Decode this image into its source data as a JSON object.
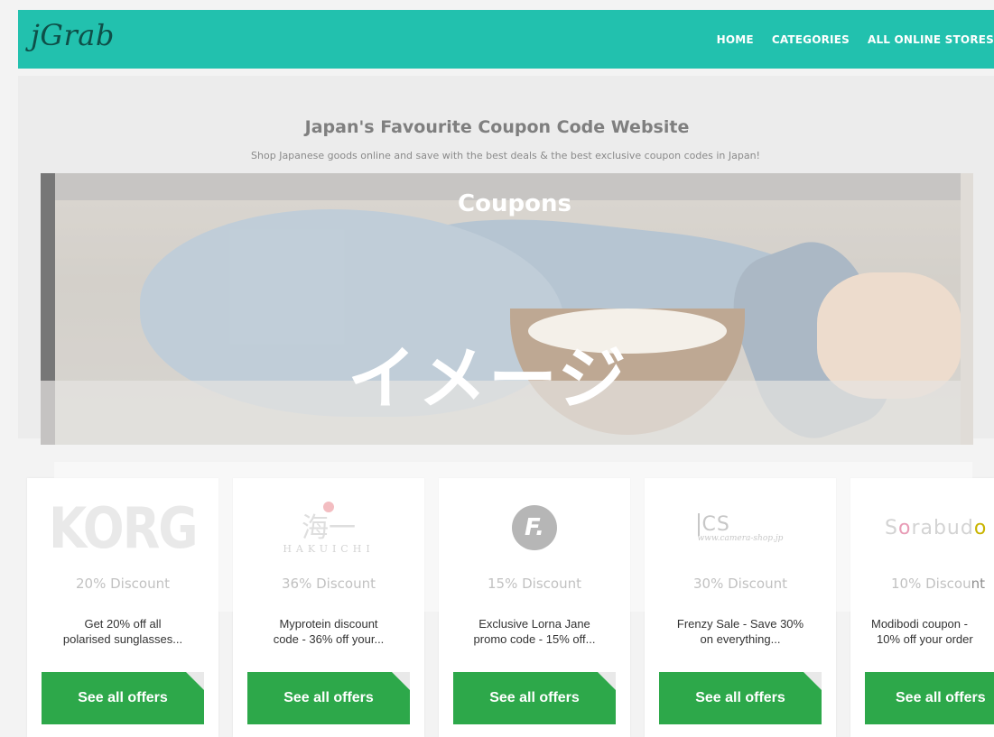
{
  "header": {
    "logo": "jGrab",
    "nav": [
      "HOME",
      "CATEGORIES",
      "ALL ONLINE STORES"
    ]
  },
  "hero": {
    "title": "Japan's Favourite Coupon Code Website",
    "subtitle": "Shop Japanese goods online and save with the best deals & the best exclusive coupon codes in Japan!",
    "banner_title": "Coupons",
    "image_mark": "イメージ"
  },
  "cards": [
    {
      "brand": "KORG",
      "discount": "20% Discount",
      "desc_line1": "Get 20% off all",
      "desc_line2": "polarised sunglasses...",
      "button": "See all offers"
    },
    {
      "brand_kanji": "海一",
      "brand_word": "HAKUICHI",
      "discount": "36% Discount",
      "desc_line1": "Myprotein discount",
      "desc_line2": "code - 36% off your...",
      "button": "See all offers"
    },
    {
      "brand": "F.",
      "discount": "15% Discount",
      "desc_line1": "Exclusive Lorna Jane",
      "desc_line2": "promo code - 15% off...",
      "button": "See all offers"
    },
    {
      "brand": "CS",
      "brand_url": "www.camera-shop.jp",
      "discount": "30% Discount",
      "desc_line1": "Frenzy Sale - Save 30%",
      "desc_line2": "on everything...",
      "button": "See all offers"
    },
    {
      "brand_pre": "S",
      "brand_o": "o",
      "brand_mid": "rabud",
      "brand_o2": "o",
      "discount": "10% Discount",
      "desc_line1": "Modibodi coupon -",
      "desc_line2": "10% off your order",
      "button": "See all offers"
    }
  ],
  "colors": {
    "header": "#22c1ae",
    "button": "#2da84a"
  }
}
